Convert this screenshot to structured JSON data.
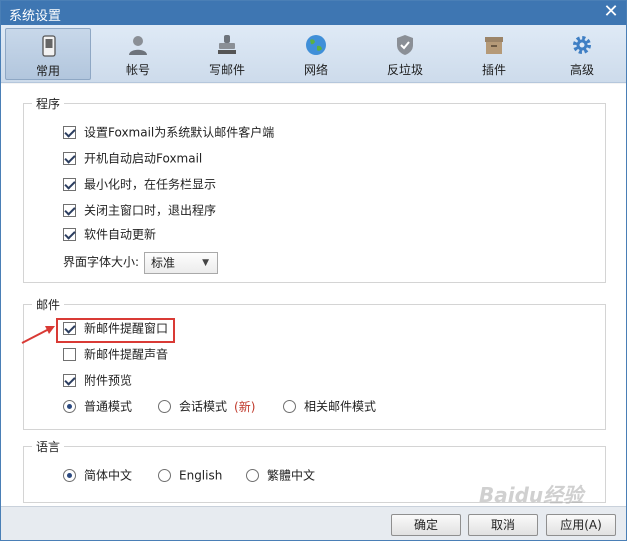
{
  "window": {
    "title": "系统设置"
  },
  "toolbar": {
    "tabs": [
      {
        "label": "常用",
        "icon": "phone-device-icon",
        "active": true
      },
      {
        "label": "帐号",
        "icon": "user-icon",
        "active": false
      },
      {
        "label": "写邮件",
        "icon": "stamp-icon",
        "active": false
      },
      {
        "label": "网络",
        "icon": "globe-icon",
        "active": false
      },
      {
        "label": "反垃圾",
        "icon": "shield-icon",
        "active": false
      },
      {
        "label": "插件",
        "icon": "box-icon",
        "active": false
      },
      {
        "label": "高级",
        "icon": "gear-icon",
        "active": false
      }
    ]
  },
  "program": {
    "title": "程序",
    "options": [
      {
        "label": "设置Foxmail为系统默认邮件客户端",
        "checked": true
      },
      {
        "label": "开机自动启动Foxmail",
        "checked": true
      },
      {
        "label": "最小化时，在任务栏显示",
        "checked": true
      },
      {
        "label": "关闭主窗口时，退出程序",
        "checked": true
      },
      {
        "label": "软件自动更新",
        "checked": true
      }
    ],
    "font_size_label": "界面字体大小:",
    "font_size_value": "标准"
  },
  "mail": {
    "title": "邮件",
    "options": [
      {
        "label": "新邮件提醒窗口",
        "checked": true
      },
      {
        "label": "新邮件提醒声音",
        "checked": false
      },
      {
        "label": "附件预览",
        "checked": true
      }
    ],
    "modes": [
      {
        "label": "普通模式",
        "selected": true
      },
      {
        "label": "会话模式",
        "selected": false,
        "tag": "(新)"
      },
      {
        "label": "相关邮件模式",
        "selected": false
      }
    ]
  },
  "language": {
    "title": "语言",
    "options": [
      {
        "label": "简体中文",
        "selected": true
      },
      {
        "label": "English",
        "selected": false
      },
      {
        "label": "繁體中文",
        "selected": false
      }
    ]
  },
  "footer": {
    "ok": "确定",
    "cancel": "取消",
    "apply": "应用(A)"
  },
  "colors": {
    "titlebar": "#3e76b2",
    "highlight": "#d93a35",
    "accent_red_text": "#c0392b"
  },
  "watermark": "Baidu经验"
}
